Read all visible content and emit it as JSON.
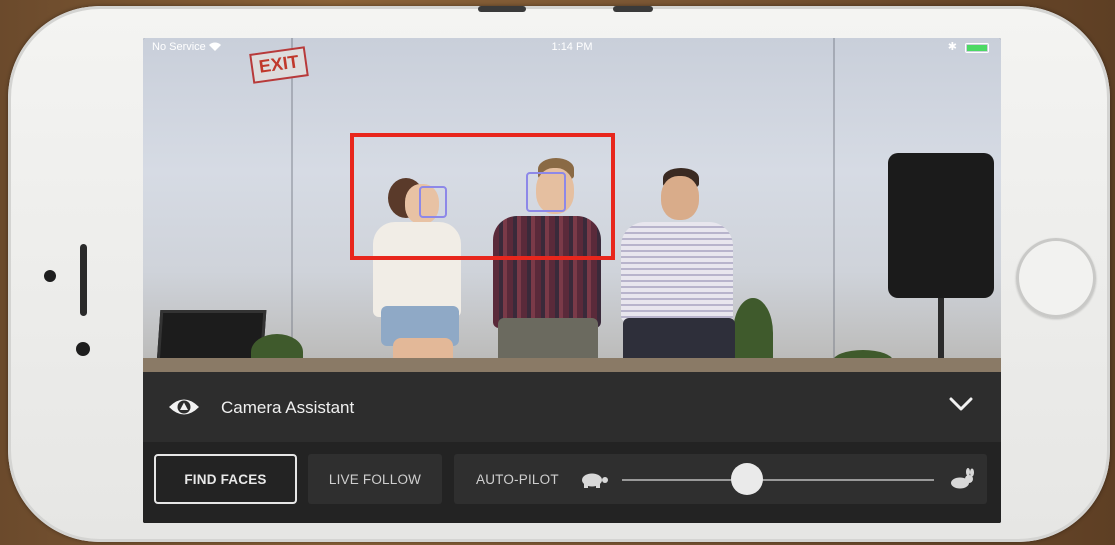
{
  "status_bar": {
    "carrier": "No Service",
    "time": "1:14 PM"
  },
  "video": {
    "exit_sign": "EXIT"
  },
  "assistant": {
    "title": "Camera Assistant"
  },
  "controls": {
    "find_faces_label": "FIND FACES",
    "live_follow_label": "LIVE FOLLOW",
    "auto_pilot_label": "AUTO-PILOT",
    "speed_slider_value": 0.4
  },
  "icons": {
    "assistant": "eye-icon",
    "collapse": "chevron-down-icon",
    "slow": "turtle-icon",
    "fast": "rabbit-icon"
  },
  "colors": {
    "highlight": "#e8261c",
    "face_box": "#8d88e8",
    "battery": "#4cd964"
  }
}
